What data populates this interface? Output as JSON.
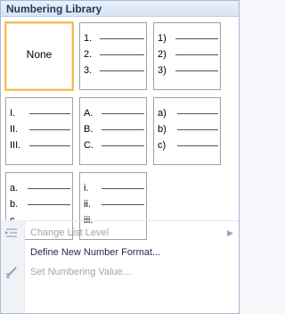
{
  "header": {
    "title": "Numbering Library"
  },
  "tiles": {
    "none": {
      "label": "None"
    },
    "t_arabic_dot": [
      "1.",
      "2.",
      "3."
    ],
    "t_arabic_paren": [
      "1)",
      "2)",
      "3)"
    ],
    "t_roman_upper": [
      "I.",
      "II.",
      "III."
    ],
    "t_alpha_upper": [
      "A.",
      "B.",
      "C."
    ],
    "t_alpha_paren": [
      "a)",
      "b)",
      "c)"
    ],
    "t_alpha_lower": [
      "a.",
      "b.",
      "c."
    ],
    "t_roman_lower": [
      "i.",
      "ii.",
      "iii."
    ]
  },
  "menu": {
    "change_level": "Change List Level",
    "define_format": "Define New Number Format...",
    "set_value": "Set Numbering Value..."
  },
  "colors": {
    "selected_border": "#f0b34a",
    "accent": "#1e395b"
  }
}
